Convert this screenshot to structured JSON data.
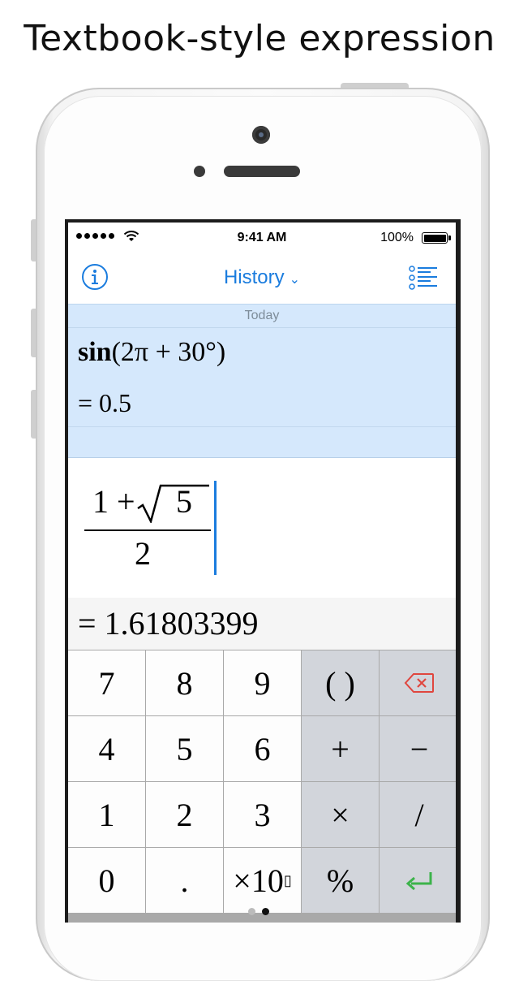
{
  "headline": "Textbook-style expression",
  "status_bar": {
    "time": "9:41 AM",
    "battery": "100%"
  },
  "nav": {
    "title": "History",
    "chevron": "⌄",
    "left_icon": "info-icon",
    "right_icon": "list-icon"
  },
  "history": {
    "date": "Today",
    "entries": [
      {
        "func": "sin",
        "args": "(2π + 30°)",
        "result": "= 0.5"
      }
    ]
  },
  "editor": {
    "numerator_prefix": "1 +",
    "radicand": "5",
    "denominator": "2"
  },
  "result": "= 1.61803399",
  "keypad": {
    "keys": [
      {
        "label": "7",
        "kind": "digit"
      },
      {
        "label": "8",
        "kind": "digit"
      },
      {
        "label": "9",
        "kind": "digit"
      },
      {
        "label": "( )",
        "kind": "op"
      },
      {
        "label": "backspace",
        "kind": "op",
        "icon": "backspace-icon"
      },
      {
        "label": "4",
        "kind": "digit"
      },
      {
        "label": "5",
        "kind": "digit"
      },
      {
        "label": "6",
        "kind": "digit"
      },
      {
        "label": "+",
        "kind": "op"
      },
      {
        "label": "−",
        "kind": "op"
      },
      {
        "label": "1",
        "kind": "digit"
      },
      {
        "label": "2",
        "kind": "digit"
      },
      {
        "label": "3",
        "kind": "digit"
      },
      {
        "label": "×",
        "kind": "op"
      },
      {
        "label": "/",
        "kind": "op"
      },
      {
        "label": "0",
        "kind": "digit"
      },
      {
        "label": ".",
        "kind": "digit"
      },
      {
        "label": "×10",
        "kind": "digit",
        "sup": "▯"
      },
      {
        "label": "%",
        "kind": "op"
      },
      {
        "label": "enter",
        "kind": "op",
        "icon": "enter-icon"
      }
    ]
  },
  "colors": {
    "accent": "#1a7cde",
    "history_bg": "#d5e8fc",
    "backspace": "#e0463e",
    "enter": "#3cb34a"
  }
}
